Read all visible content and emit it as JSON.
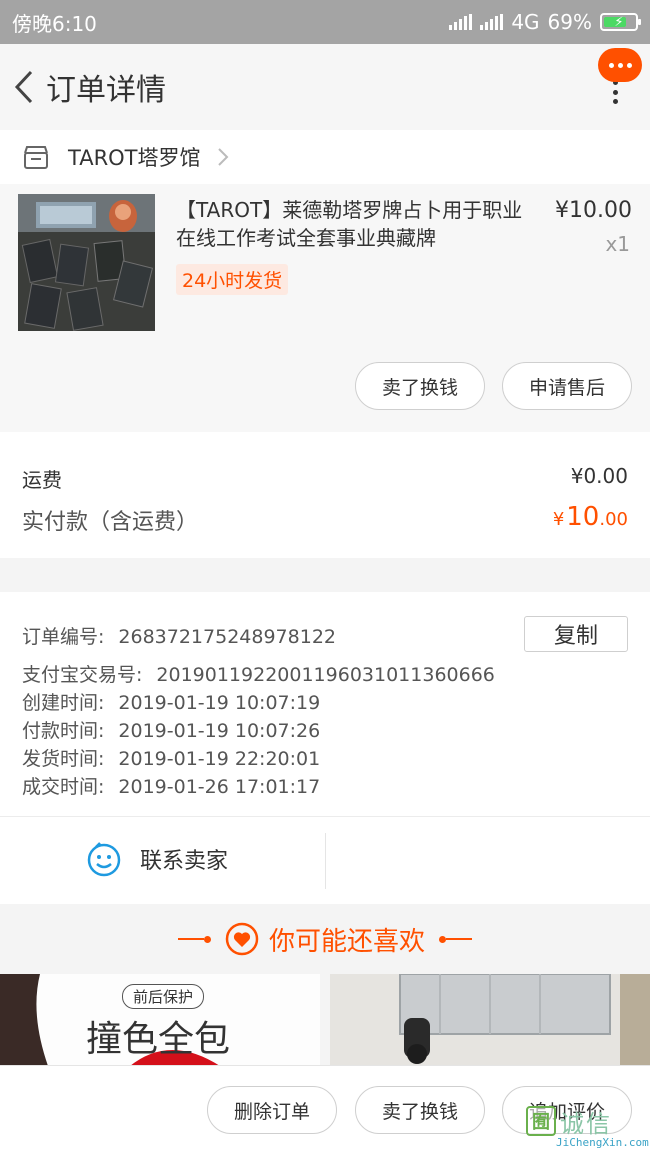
{
  "status_bar": {
    "time": "傍晚6:10",
    "network": "4G",
    "battery": "69%"
  },
  "header": {
    "title": "订单详情",
    "back_icon": "chevron-left-icon",
    "more_icon": "more-vertical-icon",
    "message_icon": "message-dots-icon",
    "accent": "#ff5000"
  },
  "shop": {
    "name": "TAROT塔罗馆",
    "icon": "store-icon"
  },
  "product": {
    "title": "【TAROT】莱德勒塔罗牌占卜用于职业在线工作考试全套事业典藏牌",
    "shipping_tag": "24小时发货",
    "price": "¥10.00",
    "quantity": "x1",
    "resell_button": "卖了换钱",
    "after_sale_button": "申请售后"
  },
  "fees": {
    "shipping_label": "运费",
    "shipping_value": "¥0.00",
    "paid_label": "实付款（含运费）",
    "paid_symbol": "¥",
    "paid_int": "10",
    "paid_dec": ".00"
  },
  "order_info": {
    "copy_button": "复制",
    "lines": [
      {
        "label": "订单编号:",
        "value": "268372175248978122"
      },
      {
        "label": "支付宝交易号:",
        "value": "2019011922001196031011360666"
      },
      {
        "label": "创建时间:",
        "value": "2019-01-19 10:07:19"
      },
      {
        "label": "付款时间:",
        "value": "2019-01-19 10:07:26"
      },
      {
        "label": "发货时间:",
        "value": "2019-01-19 22:20:01"
      },
      {
        "label": "成交时间:",
        "value": "2019-01-26 17:01:17"
      }
    ]
  },
  "contact": {
    "label": "联系卖家",
    "icon": "chat-smile-icon"
  },
  "recommend": {
    "title": "你可能还喜欢",
    "icon": "heart-icon",
    "card1_tag": "前后保护",
    "card1_text": "撞色全包"
  },
  "bottom_bar": {
    "delete_button": "删除订单",
    "resell_button": "卖了换钱",
    "review_button": "追加评价"
  },
  "watermark": {
    "cn": "诚信",
    "en": "JiChengXin.com"
  }
}
